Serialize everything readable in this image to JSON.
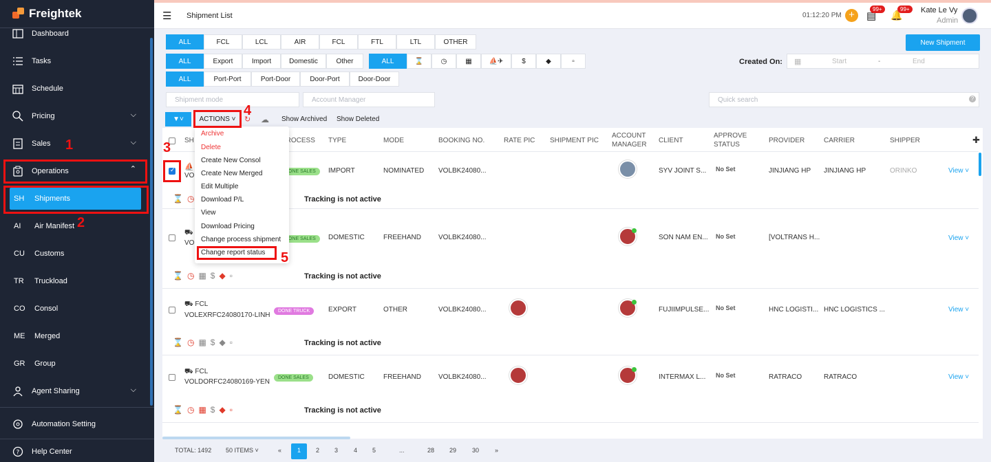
{
  "app": {
    "name": "Freightek"
  },
  "colors": {
    "accent": "#1aa3ef",
    "sidebar": "#1e2534",
    "annotation": "#ee1111"
  },
  "sidebar": {
    "items": [
      {
        "label": "Dashboard",
        "icon": "dashboard-icon"
      },
      {
        "label": "Tasks",
        "icon": "tasks-icon"
      },
      {
        "label": "Schedule",
        "icon": "calendar-icon"
      },
      {
        "label": "Pricing",
        "icon": "pricing-icon"
      },
      {
        "label": "Sales",
        "icon": "sales-icon"
      },
      {
        "label": "Operations",
        "icon": "operations-icon"
      }
    ],
    "sub": [
      {
        "abbr": "SH",
        "label": "Shipments"
      },
      {
        "abbr": "AI",
        "label": "Air Manifest"
      },
      {
        "abbr": "CU",
        "label": "Customs"
      },
      {
        "abbr": "TR",
        "label": "Truckload"
      },
      {
        "abbr": "CO",
        "label": "Consol"
      },
      {
        "abbr": "ME",
        "label": "Merged"
      },
      {
        "abbr": "GR",
        "label": "Group"
      }
    ],
    "agent": "Agent Sharing",
    "automation": "Automation Setting",
    "help": "Help Center"
  },
  "annotations": [
    "1",
    "2",
    "3",
    "4",
    "5"
  ],
  "header": {
    "title": "Shipment List",
    "time": "01:12:20 PM",
    "msg_badge": "99+",
    "notif_badge": "99+",
    "user": "Kate Le Vy",
    "role": "Admin"
  },
  "filters": {
    "mode_tabs": [
      "ALL",
      "FCL",
      "LCL",
      "AIR",
      "FCL",
      "FTL",
      "LTL",
      "OTHER"
    ],
    "type_tabs": [
      "ALL",
      "Export",
      "Import",
      "Domestic",
      "Other"
    ],
    "status_tabs": [
      "ALL"
    ],
    "route_tabs": [
      "ALL",
      "Port-Port",
      "Port-Door",
      "Door-Port",
      "Door-Door"
    ],
    "created_on": "Created On:",
    "start": "Start",
    "dash": "-",
    "end": "End",
    "shipment_mode": "Shipment mode",
    "account_manager": "Account Manager",
    "quick_search": "Quick search",
    "new_shipment": "New Shipment",
    "actions": "ACTIONS",
    "show_archived": "Show Archived",
    "show_deleted": "Show Deleted"
  },
  "columns": [
    "SH",
    "PROCESS",
    "TYPE",
    "MODE",
    "BOOKING NO.",
    "RATE PIC",
    "SHIPMENT PIC",
    "ACCOUNT MANAGER",
    "CLIENT",
    "APPROVE STATUS",
    "PROVIDER",
    "CARRIER",
    "SHIPPER"
  ],
  "menu": [
    "Archive",
    "Delete",
    "Create New Consol",
    "Create New Merged",
    "Edit Multiple",
    "Download P/L",
    "View",
    "Download Pricing",
    "Change process shipment",
    "Change report status"
  ],
  "rows": [
    {
      "kind": "",
      "id": "VO",
      "badge": "DONE SALES",
      "type": "IMPORT",
      "mode": "NOMINATED",
      "booking": "VOLBK24080...",
      "client": "SYV JOINT S...",
      "approve": "No Set",
      "provider": "JINJIANG HP",
      "carrier": "JINJIANG HP",
      "shipper": "ORINKO",
      "checked": true
    },
    {
      "kind": "",
      "id": "VO",
      "badge": "DONE SALES",
      "type": "DOMESTIC",
      "mode": "FREEHAND",
      "booking": "VOLBK24080...",
      "client": "SON NAM EN...",
      "approve": "No Set",
      "provider": "[VOLTRANS H...",
      "carrier": "",
      "shipper": "",
      "checked": false
    },
    {
      "kind": "FCL",
      "id": "VOLEXRFC24080170-LINH",
      "badge": "DONE TRUCK",
      "type": "EXPORT",
      "mode": "OTHER",
      "booking": "VOLBK24080...",
      "client": "FUJIIMPULSE...",
      "approve": "No Set",
      "provider": "HNC LOGISTI...",
      "carrier": "HNC LOGISTICS ...",
      "shipper": "",
      "checked": false
    },
    {
      "kind": "FCL",
      "id": "VOLDORFC24080169-YEN",
      "badge": "DONE SALES",
      "type": "DOMESTIC",
      "mode": "FREEHAND",
      "booking": "VOLBK24080...",
      "client": "INTERMAX L...",
      "approve": "No Set",
      "provider": "RATRACO",
      "carrier": "RATRACO",
      "shipper": "",
      "checked": false
    }
  ],
  "tracking": "Tracking is not active",
  "view": "View",
  "pager": {
    "total": "TOTAL: 1492",
    "per": "50 ITEMS",
    "pages": [
      "«",
      "1",
      "2",
      "3",
      "4",
      "5",
      "...",
      "28",
      "29",
      "30",
      "»"
    ]
  }
}
